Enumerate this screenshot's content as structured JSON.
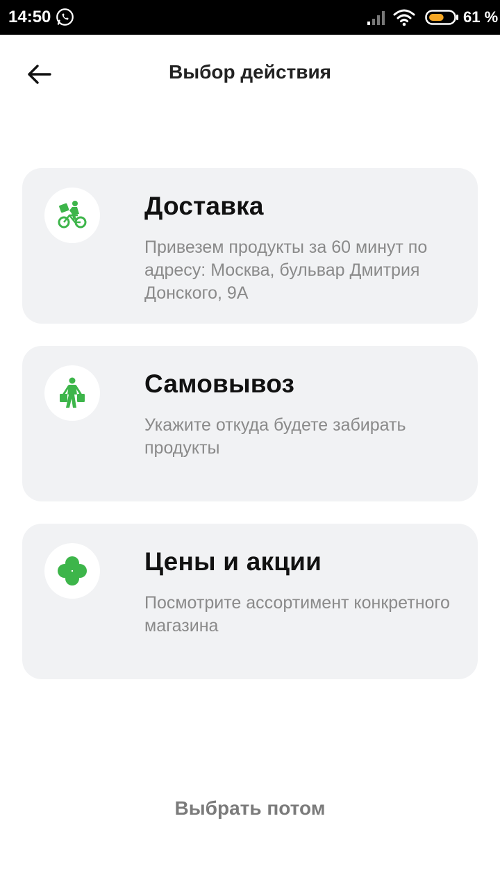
{
  "status_bar": {
    "time": "14:50",
    "battery_percent": "61 %",
    "battery_level": 0.61,
    "icons": [
      "whatsapp-icon",
      "signal-icon",
      "wifi-icon",
      "battery-icon"
    ]
  },
  "header": {
    "title": "Выбор действия",
    "back_icon": "back-arrow-icon"
  },
  "options": [
    {
      "title": "Доставка",
      "description": "Привезем продукты за 60 минут по адресу: Москва, бульвар Дмитрия Донского, 9А",
      "icon": "courier-bike-icon"
    },
    {
      "title": "Самовывоз",
      "description": "Укажите откуда будете забирать продукты",
      "icon": "pickup-person-icon"
    },
    {
      "title": "Цены и акции",
      "description": "Посмотрите ассортимент конкретного магазина",
      "icon": "clover-icon"
    }
  ],
  "footer": {
    "later_label": "Выбрать потом"
  },
  "colors": {
    "accent_green": "#3db54a",
    "card_bg": "#f1f2f4",
    "battery_fill": "#f5a623"
  }
}
